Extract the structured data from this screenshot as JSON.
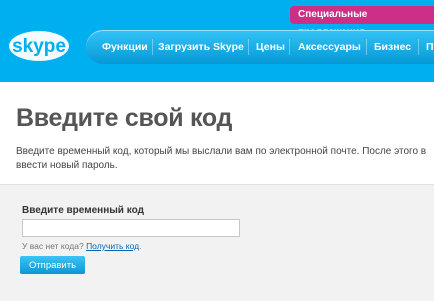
{
  "header": {
    "promo_label": "Специальные предложения",
    "logo_text": "skype",
    "nav": [
      "Функции",
      "Загрузить Skype",
      "Цены",
      "Аксессуары",
      "Бизнес",
      "По"
    ]
  },
  "main": {
    "title": "Введите свой код",
    "description": "Введите временный код, который мы выслали вам по электронной почте. После этого в ввести новый пароль."
  },
  "form": {
    "label": "Введите временный код",
    "input_value": "",
    "no_code_text": "У вас нет кода?",
    "get_code_link": "Получить код",
    "submit_label": "Отправить"
  },
  "colors": {
    "header_bg": "#00aff0",
    "promo_bg": "#cc2f86",
    "link": "#0067b8",
    "button": "#0b97d4"
  }
}
